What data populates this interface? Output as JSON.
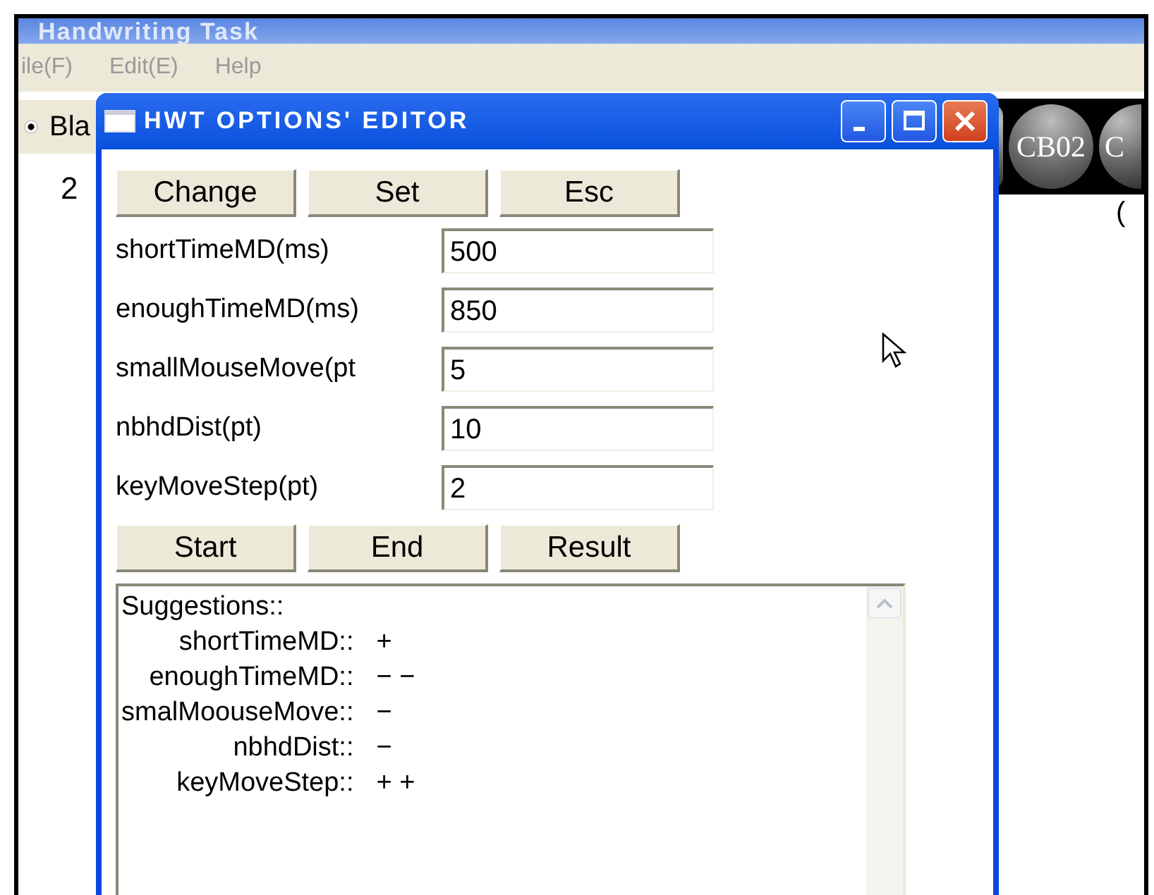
{
  "app_window": {
    "title": "Handwriting Task",
    "menu": [
      "ile(F)",
      "Edit(E)",
      "Help"
    ],
    "radio": {
      "label": "Bla",
      "checked": true
    },
    "value_text": "2",
    "paren_text": "(",
    "cb_buttons": [
      "CB02",
      "C"
    ]
  },
  "dialog": {
    "title": "HWT OPTIONS' EDITOR",
    "top_buttons": [
      "Change",
      "Set",
      "Esc"
    ],
    "fields": [
      {
        "label": "shortTimeMD(ms)",
        "value": "500"
      },
      {
        "label": "enoughTimeMD(ms)",
        "value": "850"
      },
      {
        "label": "smallMouseMove(pt",
        "value": "5"
      },
      {
        "label": "nbhdDist(pt)",
        "value": "10"
      },
      {
        "label": "keyMoveStep(pt)",
        "value": "2"
      }
    ],
    "bottom_buttons": [
      "Start",
      "End",
      "Result"
    ],
    "suggestions": {
      "header": "Suggestions::",
      "rows": [
        {
          "name": "shortTimeMD::",
          "mark": "+"
        },
        {
          "name": "enoughTimeMD::",
          "mark": "− −"
        },
        {
          "name": "smalMoouseMove::",
          "mark": "−"
        },
        {
          "name": "nbhdDist::",
          "mark": "−"
        },
        {
          "name": "keyMoveStep::",
          "mark": "+ +"
        }
      ]
    }
  }
}
